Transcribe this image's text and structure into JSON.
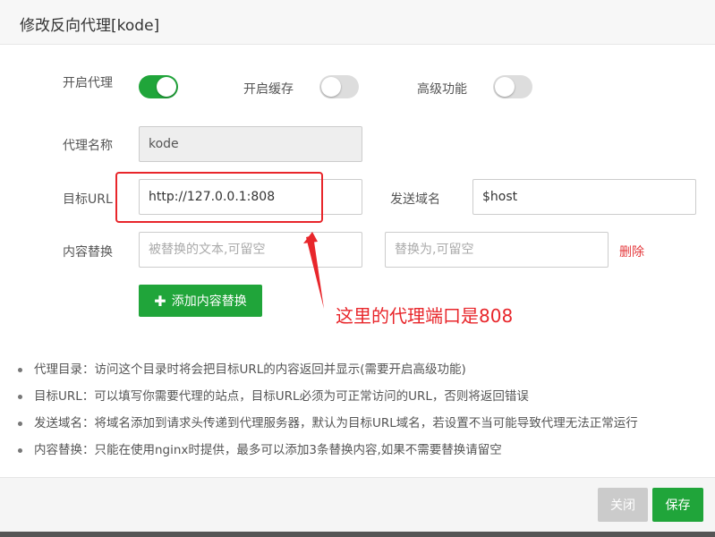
{
  "dialog": {
    "title": "修改反向代理[kode]"
  },
  "form": {
    "enable_proxy": {
      "label": "开启代理",
      "state": "on"
    },
    "enable_cache": {
      "label": "开启缓存",
      "state": "off"
    },
    "advanced": {
      "label": "高级功能",
      "state": "off"
    },
    "proxy_name": {
      "label": "代理名称",
      "value": "kode"
    },
    "target_url": {
      "label": "目标URL",
      "value": "http://127.0.0.1:808"
    },
    "send_domain": {
      "label": "发送域名",
      "value": "$host"
    },
    "content_replace": {
      "label": "内容替换",
      "from_placeholder": "被替换的文本,可留空",
      "to_placeholder": "替换为,可留空",
      "delete_label": "删除"
    },
    "add_replace_label": "添加内容替换"
  },
  "annotation": {
    "text": "这里的代理端口是808"
  },
  "notes": [
    "代理目录：访问这个目录时将会把目标URL的内容返回并显示(需要开启高级功能)",
    "目标URL：可以填写你需要代理的站点，目标URL必须为可正常访问的URL，否则将返回错误",
    "发送域名：将域名添加到请求头传递到代理服务器，默认为目标URL域名，若设置不当可能导致代理无法正常运行",
    "内容替换：只能在使用nginx时提供，最多可以添加3条替换内容,如果不需要替换请留空"
  ],
  "footer": {
    "close_label": "关闭",
    "save_label": "保存"
  },
  "colors": {
    "accent": "#20a53a",
    "annotation": "#e8262b",
    "delete": "#e4393c"
  },
  "icons": {
    "plus": "plus-icon"
  }
}
